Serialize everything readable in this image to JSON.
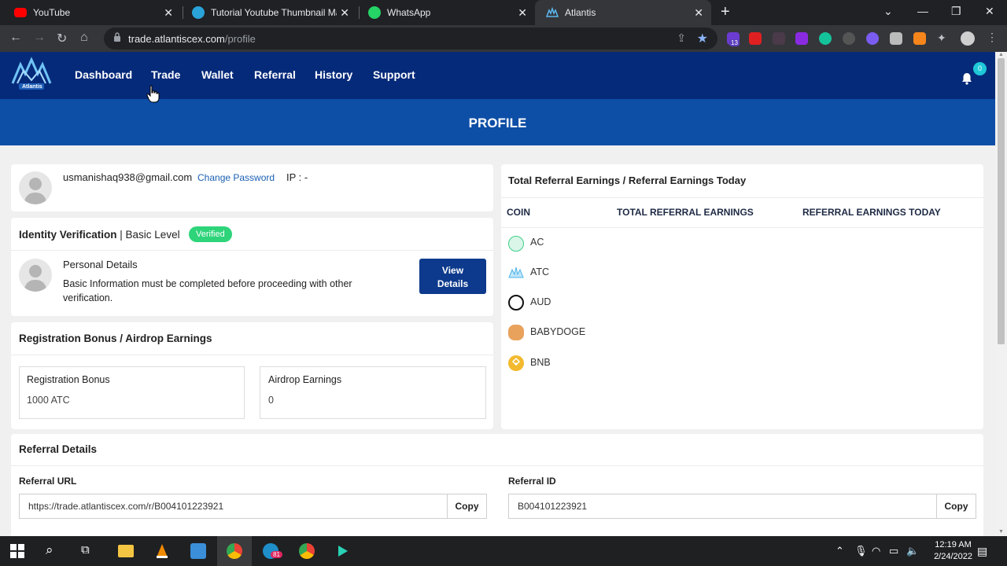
{
  "browser": {
    "tabs": [
      {
        "label": "YouTube",
        "icon": "youtube-icon",
        "active": false
      },
      {
        "label": "Tutorial Youtube Thumbnail Mak",
        "icon": "canva-icon",
        "active": false
      },
      {
        "label": "WhatsApp",
        "icon": "whatsapp-icon",
        "active": false
      },
      {
        "label": "Atlantis",
        "icon": "atlantis-icon",
        "active": true
      }
    ],
    "url_host": "trade.atlantiscex.com",
    "url_path": "/profile",
    "ext_badge": "13"
  },
  "nav": {
    "logo_text": "Atlantis",
    "items": [
      "Dashboard",
      "Trade",
      "Wallet",
      "Referral",
      "History",
      "Support"
    ],
    "notification_count": "0"
  },
  "banner": {
    "title": "PROFILE"
  },
  "account": {
    "email": "usmanishaq938@gmail.com",
    "change_password": "Change Password",
    "ip": "IP : -"
  },
  "identity": {
    "title": "Identity Verification",
    "level": " | Basic Level",
    "status": "Verified",
    "personal_title": "Personal Details",
    "personal_desc_1": "Basic Information must be completed before proceeding with other",
    "personal_desc_2": "verification.",
    "view_line1": "View",
    "view_line2": "Details"
  },
  "bonus": {
    "title": "Registration Bonus / Airdrop Earnings",
    "reg_label": "Registration Bonus",
    "reg_value": "1000 ATC",
    "air_label": "Airdrop Earnings",
    "air_value": "0"
  },
  "earnings": {
    "title": "Total Referral Earnings / Referral Earnings Today",
    "columns": [
      "COIN",
      "TOTAL REFERRAL EARNINGS",
      "REFERRAL EARNINGS TODAY"
    ],
    "coins": [
      {
        "name": "AC",
        "color": "#3ecf8e"
      },
      {
        "name": "ATC",
        "color": "#4ab3e8"
      },
      {
        "name": "AUD",
        "color": "#111111"
      },
      {
        "name": "BABYDOGE",
        "color": "#d98b3a"
      },
      {
        "name": "BNB",
        "color": "#f3ba2f"
      }
    ]
  },
  "referral": {
    "title": "Referral Details",
    "url_label": "Referral URL",
    "url_value": "https://trade.atlantiscex.com/r/B004101223921",
    "id_label": "Referral ID",
    "id_value": "B004101223921",
    "copy": "Copy"
  },
  "taskbar": {
    "time": "12:19 AM",
    "date": "2/24/2022",
    "chrome_badge": "81"
  },
  "colors": {
    "nav_bg": "#062a7a",
    "banner_bg": "#0d4ea6",
    "verified": "#2ed47a",
    "button": "#0d3a8c"
  }
}
